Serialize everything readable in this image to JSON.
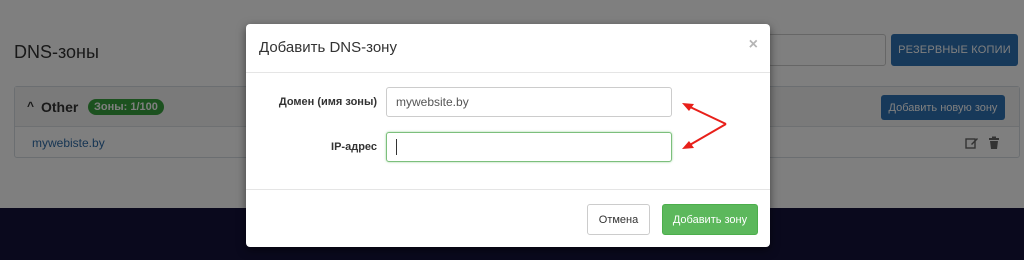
{
  "page": {
    "title": "DNS-зоны",
    "backup_button": "РЕЗЕРВНЫЕ КОПИИ",
    "zone_group": {
      "name": "Other",
      "badge": "Зоны: 1/100",
      "add_button": "Добавить новую зону",
      "zones": [
        "mywebiste.by"
      ]
    }
  },
  "modal": {
    "title": "Добавить DNS-зону",
    "close": "×",
    "domain_label": "Домен (имя зоны)",
    "domain_value": "mywebsite.by",
    "ip_label": "IP-адрес",
    "ip_value": "",
    "cancel_button": "Отмена",
    "submit_button": "Добавить зону"
  },
  "colors": {
    "primary": "#2f73b4",
    "success": "#5cb85c",
    "badge_green": "#39a33f",
    "annotation_red": "#e8201a",
    "footer_dark": "#14123a"
  }
}
